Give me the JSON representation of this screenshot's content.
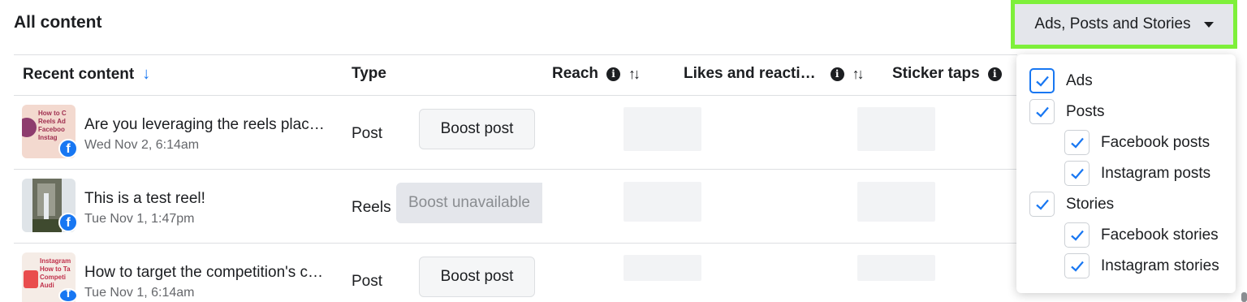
{
  "page_title": "All content",
  "filter": {
    "label": "Ads, Posts and Stories"
  },
  "table": {
    "headers": {
      "recent_content": "Recent content",
      "type": "Type",
      "reach": "Reach",
      "likes": "Likes and reacti…",
      "sticker_taps": "Sticker taps"
    },
    "rows": [
      {
        "title": "Are you leveraging the reels plac…",
        "date": "Wed Nov 2, 6:14am",
        "type": "Post",
        "action": "Boost post",
        "thumb_text": "How to C\nReels Ad\nFaceboo\nInstag"
      },
      {
        "title": "This is a test reel!",
        "date": "Tue Nov 1, 1:47pm",
        "type": "Reels",
        "action": "Boost unavailable"
      },
      {
        "title": "How to target the competition's c…",
        "date": "Tue Nov 1, 6:14am",
        "type": "Post",
        "action": "Boost post",
        "thumb_text": "Instagram\nHow to Ta\nCompeti\nAudi"
      }
    ]
  },
  "dropdown": {
    "options": [
      {
        "label": "Ads",
        "checked": true
      },
      {
        "label": "Posts",
        "checked": true
      },
      {
        "label": "Facebook posts",
        "checked": true
      },
      {
        "label": "Instagram posts",
        "checked": true
      },
      {
        "label": "Stories",
        "checked": true
      },
      {
        "label": "Facebook stories",
        "checked": true
      },
      {
        "label": "Instagram stories",
        "checked": true
      }
    ]
  },
  "icons": {
    "facebook_badge": "f",
    "info": "i",
    "sort_down": "↓",
    "sort_toggle": "↑↓"
  },
  "colors": {
    "accent": "#1877f2",
    "highlight": "#7ef03a",
    "button_bg": "#e4e6eb"
  }
}
